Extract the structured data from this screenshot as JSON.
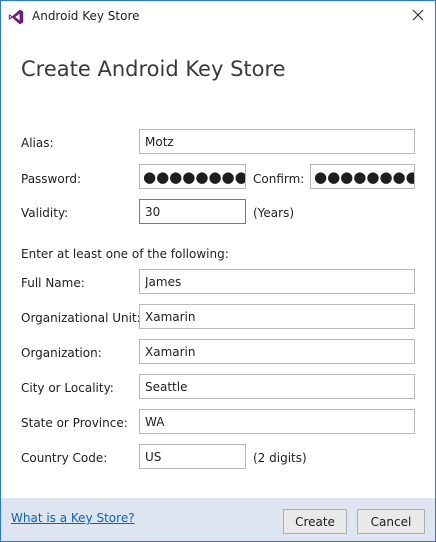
{
  "window": {
    "title": "Android Key Store",
    "close_glyph": "✕"
  },
  "heading": "Create Android Key Store",
  "form": {
    "alias": {
      "label": "Alias:",
      "value": "Motz"
    },
    "password": {
      "label": "Password:",
      "value": "●●●●●●●●●"
    },
    "confirm": {
      "label": "Confirm:",
      "value": "●●●●●●●●●"
    },
    "validity": {
      "label": "Validity:",
      "value": "30",
      "unit": "(Years)"
    },
    "instruction": "Enter at least one of the following:",
    "full_name": {
      "label": "Full Name:",
      "value": "James"
    },
    "org_unit": {
      "label": "Organizational Unit:",
      "value": "Xamarin"
    },
    "organization": {
      "label": "Organization:",
      "value": "Xamarin"
    },
    "city": {
      "label": "City or Locality:",
      "value": "Seattle"
    },
    "state": {
      "label": "State or Province:",
      "value": "WA"
    },
    "country": {
      "label": "Country Code:",
      "value": "US",
      "hint": "(2 digits)"
    }
  },
  "footer": {
    "help_link": "What is a Key Store?",
    "create_label": "Create",
    "cancel_label": "Cancel"
  },
  "colors": {
    "window_border": "#2b7bd6",
    "app_icon": "#68217a",
    "focus_border": "#3c88d4",
    "footer_bg": "#dde5f1",
    "link": "#0b62c0"
  },
  "icons": {
    "app": "visual-studio-icon",
    "close": "close-icon"
  }
}
